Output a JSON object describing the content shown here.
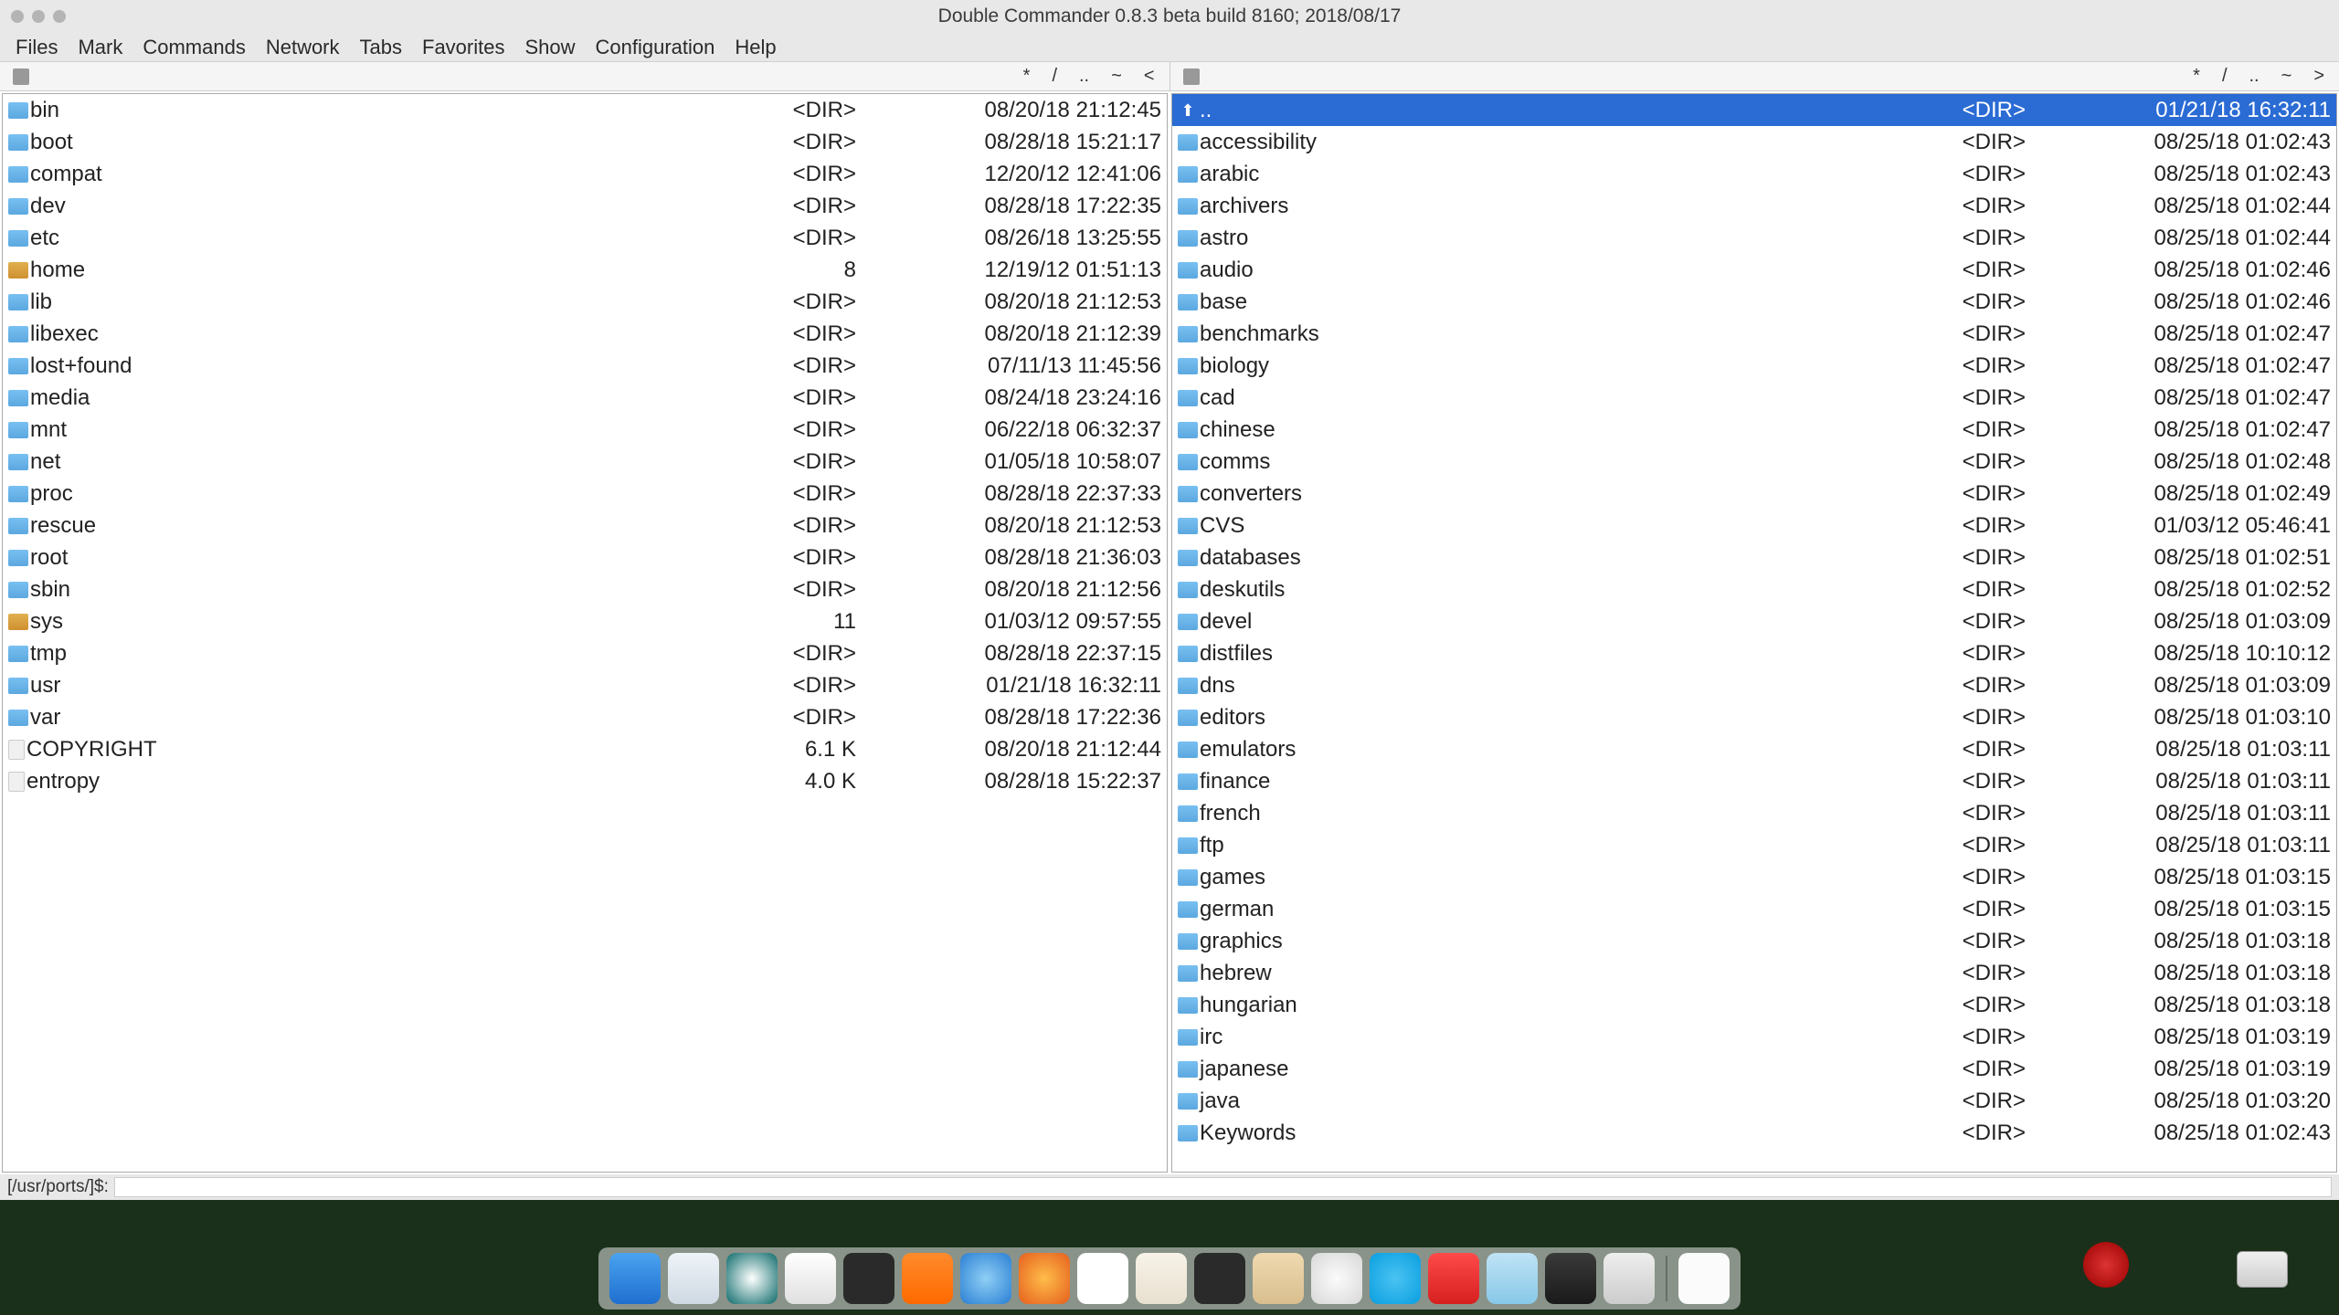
{
  "title": "Double Commander 0.8.3 beta build 8160; 2018/08/17",
  "menu": [
    "Files",
    "Mark",
    "Commands",
    "Network",
    "Tabs",
    "Favorites",
    "Show",
    "Configuration",
    "Help"
  ],
  "nav": [
    "*",
    "/",
    "..",
    "~",
    "<"
  ],
  "navRight": [
    "*",
    "/",
    "..",
    "~",
    ">"
  ],
  "cmdPrompt": "[/usr/ports/]$:",
  "left": {
    "items": [
      {
        "name": "bin",
        "type": "folder",
        "size": "<DIR>",
        "date": "08/20/18 21:12:45"
      },
      {
        "name": "boot",
        "type": "folder",
        "size": "<DIR>",
        "date": "08/28/18 15:21:17"
      },
      {
        "name": "compat",
        "type": "folder",
        "size": "<DIR>",
        "date": "12/20/12 12:41:06"
      },
      {
        "name": "dev",
        "type": "folder",
        "size": "<DIR>",
        "date": "08/28/18 17:22:35"
      },
      {
        "name": "etc",
        "type": "folder",
        "size": "<DIR>",
        "date": "08/26/18 13:25:55"
      },
      {
        "name": "home",
        "type": "link",
        "size": "8",
        "date": "12/19/12 01:51:13"
      },
      {
        "name": "lib",
        "type": "folder",
        "size": "<DIR>",
        "date": "08/20/18 21:12:53"
      },
      {
        "name": "libexec",
        "type": "folder",
        "size": "<DIR>",
        "date": "08/20/18 21:12:39"
      },
      {
        "name": "lost+found",
        "type": "folder",
        "size": "<DIR>",
        "date": "07/11/13 11:45:56"
      },
      {
        "name": "media",
        "type": "folder",
        "size": "<DIR>",
        "date": "08/24/18 23:24:16"
      },
      {
        "name": "mnt",
        "type": "folder",
        "size": "<DIR>",
        "date": "06/22/18 06:32:37"
      },
      {
        "name": "net",
        "type": "folder",
        "size": "<DIR>",
        "date": "01/05/18 10:58:07"
      },
      {
        "name": "proc",
        "type": "folder",
        "size": "<DIR>",
        "date": "08/28/18 22:37:33"
      },
      {
        "name": "rescue",
        "type": "folder",
        "size": "<DIR>",
        "date": "08/20/18 21:12:53"
      },
      {
        "name": "root",
        "type": "folder",
        "size": "<DIR>",
        "date": "08/28/18 21:36:03"
      },
      {
        "name": "sbin",
        "type": "folder",
        "size": "<DIR>",
        "date": "08/20/18 21:12:56"
      },
      {
        "name": "sys",
        "type": "link",
        "size": "11",
        "date": "01/03/12 09:57:55"
      },
      {
        "name": "tmp",
        "type": "folder",
        "size": "<DIR>",
        "date": "08/28/18 22:37:15"
      },
      {
        "name": "usr",
        "type": "folder",
        "size": "<DIR>",
        "date": "01/21/18 16:32:11"
      },
      {
        "name": "var",
        "type": "folder",
        "size": "<DIR>",
        "date": "08/28/18 17:22:36"
      },
      {
        "name": "COPYRIGHT",
        "type": "file",
        "size": "6.1 K",
        "date": "08/20/18 21:12:44"
      },
      {
        "name": "entropy",
        "type": "file",
        "size": "4.0 K",
        "date": "08/28/18 15:22:37"
      }
    ]
  },
  "right": {
    "items": [
      {
        "name": "..",
        "type": "updir",
        "size": "<DIR>",
        "date": "01/21/18 16:32:11",
        "selected": true
      },
      {
        "name": "accessibility",
        "type": "folder",
        "size": "<DIR>",
        "date": "08/25/18 01:02:43"
      },
      {
        "name": "arabic",
        "type": "folder",
        "size": "<DIR>",
        "date": "08/25/18 01:02:43"
      },
      {
        "name": "archivers",
        "type": "folder",
        "size": "<DIR>",
        "date": "08/25/18 01:02:44"
      },
      {
        "name": "astro",
        "type": "folder",
        "size": "<DIR>",
        "date": "08/25/18 01:02:44"
      },
      {
        "name": "audio",
        "type": "folder",
        "size": "<DIR>",
        "date": "08/25/18 01:02:46"
      },
      {
        "name": "base",
        "type": "folder",
        "size": "<DIR>",
        "date": "08/25/18 01:02:46"
      },
      {
        "name": "benchmarks",
        "type": "folder",
        "size": "<DIR>",
        "date": "08/25/18 01:02:47"
      },
      {
        "name": "biology",
        "type": "folder",
        "size": "<DIR>",
        "date": "08/25/18 01:02:47"
      },
      {
        "name": "cad",
        "type": "folder",
        "size": "<DIR>",
        "date": "08/25/18 01:02:47"
      },
      {
        "name": "chinese",
        "type": "folder",
        "size": "<DIR>",
        "date": "08/25/18 01:02:47"
      },
      {
        "name": "comms",
        "type": "folder",
        "size": "<DIR>",
        "date": "08/25/18 01:02:48"
      },
      {
        "name": "converters",
        "type": "folder",
        "size": "<DIR>",
        "date": "08/25/18 01:02:49"
      },
      {
        "name": "CVS",
        "type": "folder",
        "size": "<DIR>",
        "date": "01/03/12 05:46:41"
      },
      {
        "name": "databases",
        "type": "folder",
        "size": "<DIR>",
        "date": "08/25/18 01:02:51"
      },
      {
        "name": "deskutils",
        "type": "folder",
        "size": "<DIR>",
        "date": "08/25/18 01:02:52"
      },
      {
        "name": "devel",
        "type": "folder",
        "size": "<DIR>",
        "date": "08/25/18 01:03:09"
      },
      {
        "name": "distfiles",
        "type": "folder",
        "size": "<DIR>",
        "date": "08/25/18 10:10:12"
      },
      {
        "name": "dns",
        "type": "folder",
        "size": "<DIR>",
        "date": "08/25/18 01:03:09"
      },
      {
        "name": "editors",
        "type": "folder",
        "size": "<DIR>",
        "date": "08/25/18 01:03:10"
      },
      {
        "name": "emulators",
        "type": "folder",
        "size": "<DIR>",
        "date": "08/25/18 01:03:11"
      },
      {
        "name": "finance",
        "type": "folder",
        "size": "<DIR>",
        "date": "08/25/18 01:03:11"
      },
      {
        "name": "french",
        "type": "folder",
        "size": "<DIR>",
        "date": "08/25/18 01:03:11"
      },
      {
        "name": "ftp",
        "type": "folder",
        "size": "<DIR>",
        "date": "08/25/18 01:03:11"
      },
      {
        "name": "games",
        "type": "folder",
        "size": "<DIR>",
        "date": "08/25/18 01:03:15"
      },
      {
        "name": "german",
        "type": "folder",
        "size": "<DIR>",
        "date": "08/25/18 01:03:15"
      },
      {
        "name": "graphics",
        "type": "folder",
        "size": "<DIR>",
        "date": "08/25/18 01:03:18"
      },
      {
        "name": "hebrew",
        "type": "folder",
        "size": "<DIR>",
        "date": "08/25/18 01:03:18"
      },
      {
        "name": "hungarian",
        "type": "folder",
        "size": "<DIR>",
        "date": "08/25/18 01:03:18"
      },
      {
        "name": "irc",
        "type": "folder",
        "size": "<DIR>",
        "date": "08/25/18 01:03:19"
      },
      {
        "name": "japanese",
        "type": "folder",
        "size": "<DIR>",
        "date": "08/25/18 01:03:19"
      },
      {
        "name": "java",
        "type": "folder",
        "size": "<DIR>",
        "date": "08/25/18 01:03:20"
      },
      {
        "name": "Keywords",
        "type": "folder",
        "size": "<DIR>",
        "date": "08/25/18 01:02:43"
      }
    ]
  },
  "dockIcons": [
    {
      "name": "finder",
      "color": "linear-gradient(#4aa3ef,#1f6fd0)"
    },
    {
      "name": "window",
      "color": "linear-gradient(#eef3f8,#cfd9e3)"
    },
    {
      "name": "contrast",
      "color": "radial-gradient(circle,#fff,#0c6a6a)"
    },
    {
      "name": "textedit",
      "color": "linear-gradient(#fff,#e0e0e0)"
    },
    {
      "name": "terminal",
      "color": "#2a2a2a"
    },
    {
      "name": "calc",
      "color": "linear-gradient(#ff8a2b,#ff6a00)"
    },
    {
      "name": "browser",
      "color": "radial-gradient(circle,#8fcff5,#2a7fd4)"
    },
    {
      "name": "firefox",
      "color": "radial-gradient(circle,#ffbd4a,#e55f1d)"
    },
    {
      "name": "charts",
      "color": "#fff"
    },
    {
      "name": "notes",
      "color": "linear-gradient(#f8f3e8,#e8e0d0)"
    },
    {
      "name": "activity",
      "color": "#2a2a2a"
    },
    {
      "name": "filemgr",
      "color": "linear-gradient(#f0d9b0,#d9bf8f)"
    },
    {
      "name": "clock",
      "color": "radial-gradient(circle,#fbfbfb,#d8d8d8)"
    },
    {
      "name": "skype",
      "color": "radial-gradient(circle,#4ac3f2,#0a9fe0)"
    },
    {
      "name": "graph",
      "color": "linear-gradient(#ff4a4a,#d62020)"
    },
    {
      "name": "preview",
      "color": "linear-gradient(#bfe3f5,#88c8e8)"
    },
    {
      "name": "pdf",
      "color": "linear-gradient(#3a3a3a,#1a1a1a)"
    },
    {
      "name": "trash",
      "color": "linear-gradient(#eee,#ccc)"
    },
    {
      "name": "term2",
      "color": "#fbfbfb"
    }
  ]
}
